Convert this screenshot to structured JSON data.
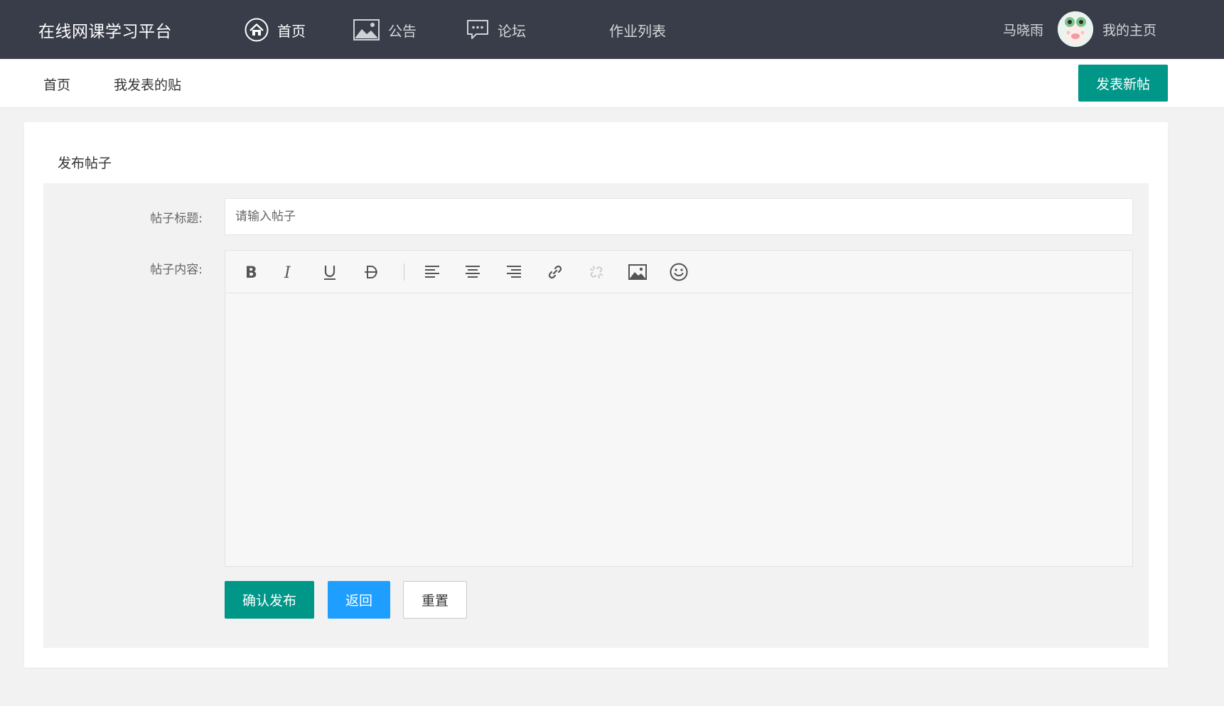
{
  "header": {
    "brand": "在线网课学习平台",
    "nav": [
      {
        "label": "首页",
        "icon": "home-icon"
      },
      {
        "label": "公告",
        "icon": "image-icon"
      },
      {
        "label": "论坛",
        "icon": "chat-icon"
      },
      {
        "label": "作业列表"
      }
    ],
    "user_name": "马晓雨",
    "my_home": "我的主页"
  },
  "subnav": {
    "items": [
      {
        "label": "首页"
      },
      {
        "label": "我发表的贴"
      }
    ],
    "new_post_button": "发表新帖"
  },
  "form": {
    "card_title": "发布帖子",
    "title_label": "帖子标题:",
    "title_placeholder": "请输入帖子",
    "title_value": "",
    "content_label": "帖子内容:",
    "toolbar": [
      "bold",
      "italic",
      "underline",
      "strikethrough",
      "align-left",
      "align-center",
      "align-right",
      "link",
      "unlink",
      "image",
      "emoji"
    ],
    "buttons": {
      "confirm": "确认发布",
      "back": "返回",
      "reset": "重置"
    }
  },
  "colors": {
    "topbar": "#393d49",
    "primary": "#009688",
    "blue": "#1e9fff"
  }
}
